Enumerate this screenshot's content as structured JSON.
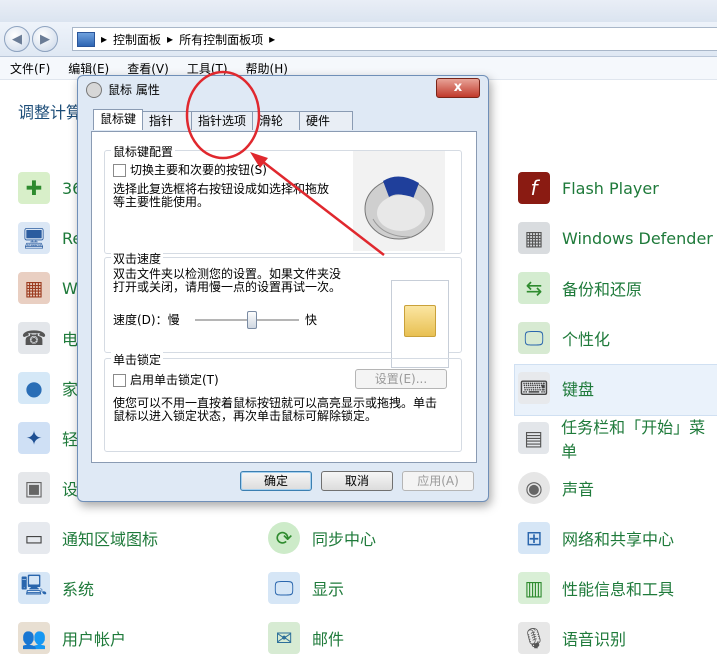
{
  "address": {
    "path": [
      "控制面板",
      "所有控制面板项"
    ]
  },
  "menu": [
    "文件(F)",
    "编辑(E)",
    "查看(V)",
    "工具(T)",
    "帮助(H)"
  ],
  "page_heading": "调整计算机的设置",
  "cp_items_col1": [
    {
      "label": "360",
      "icon": "shield-icon"
    },
    {
      "label": "Re",
      "icon": "network-icon"
    },
    {
      "label": "Wi",
      "icon": "firewall-icon"
    },
    {
      "label": "电",
      "icon": "phone-icon"
    },
    {
      "label": "家",
      "icon": "homegroup-icon"
    },
    {
      "label": "轻",
      "icon": "ease-access-icon"
    },
    {
      "label": "设",
      "icon": "device-icon"
    },
    {
      "label": "通知区域图标",
      "icon": "notification-icon"
    },
    {
      "label": "系统",
      "icon": "system-icon"
    },
    {
      "label": "用户帐户",
      "icon": "users-icon"
    }
  ],
  "cp_items_col2": [
    {
      "label": "同步中心",
      "icon": "sync-icon"
    },
    {
      "label": "显示",
      "icon": "display-icon"
    },
    {
      "label": "邮件",
      "icon": "mail-icon"
    }
  ],
  "cp_items_col3": [
    {
      "label": "Flash Player",
      "icon": "flash-icon"
    },
    {
      "label": "Windows Defender",
      "icon": "defender-icon"
    },
    {
      "label": "备份和还原",
      "icon": "backup-icon"
    },
    {
      "label": "个性化",
      "icon": "personalize-icon"
    },
    {
      "label": "键盘",
      "icon": "keyboard-icon"
    },
    {
      "label": "任务栏和「开始」菜单",
      "icon": "taskbar-icon"
    },
    {
      "label": "声音",
      "icon": "sound-icon"
    },
    {
      "label": "网络和共享中心",
      "icon": "network-share-icon"
    },
    {
      "label": "性能信息和工具",
      "icon": "performance-icon"
    },
    {
      "label": "语音识别",
      "icon": "microphone-icon"
    }
  ],
  "dialog": {
    "title": "鼠标 属性",
    "close": "x",
    "tabs": [
      "鼠标键",
      "指针",
      "指针选项",
      "滑轮",
      "硬件"
    ],
    "config": {
      "label": "鼠标键配置",
      "checkbox": "切换主要和次要的按钮(S)",
      "desc1": "选择此复选框将右按钮设成如选择和拖放",
      "desc2": "等主要性能使用。"
    },
    "speed": {
      "label": "双击速度",
      "desc1": "双击文件夹以检测您的设置。如果文件夹没",
      "desc2": "打开或关闭，请用慢一点的设置再试一次。",
      "speed_label": "速度(D)：慢",
      "fast_label": "快",
      "value": 0.55
    },
    "clicklock": {
      "label": "单击锁定",
      "checkbox": "启用单击锁定(T)",
      "settings_btn": "设置(E)...",
      "desc1": "使您可以不用一直按着鼠标按钮就可以高亮显示或拖拽。单击",
      "desc2": "鼠标以进入锁定状态，再次单击鼠标可解除锁定。"
    },
    "buttons": {
      "ok": "确定",
      "cancel": "取消",
      "apply": "应用(A)"
    }
  },
  "colors": {
    "link_green": "#1e7a3a",
    "annotation_red": "#e0282e"
  }
}
